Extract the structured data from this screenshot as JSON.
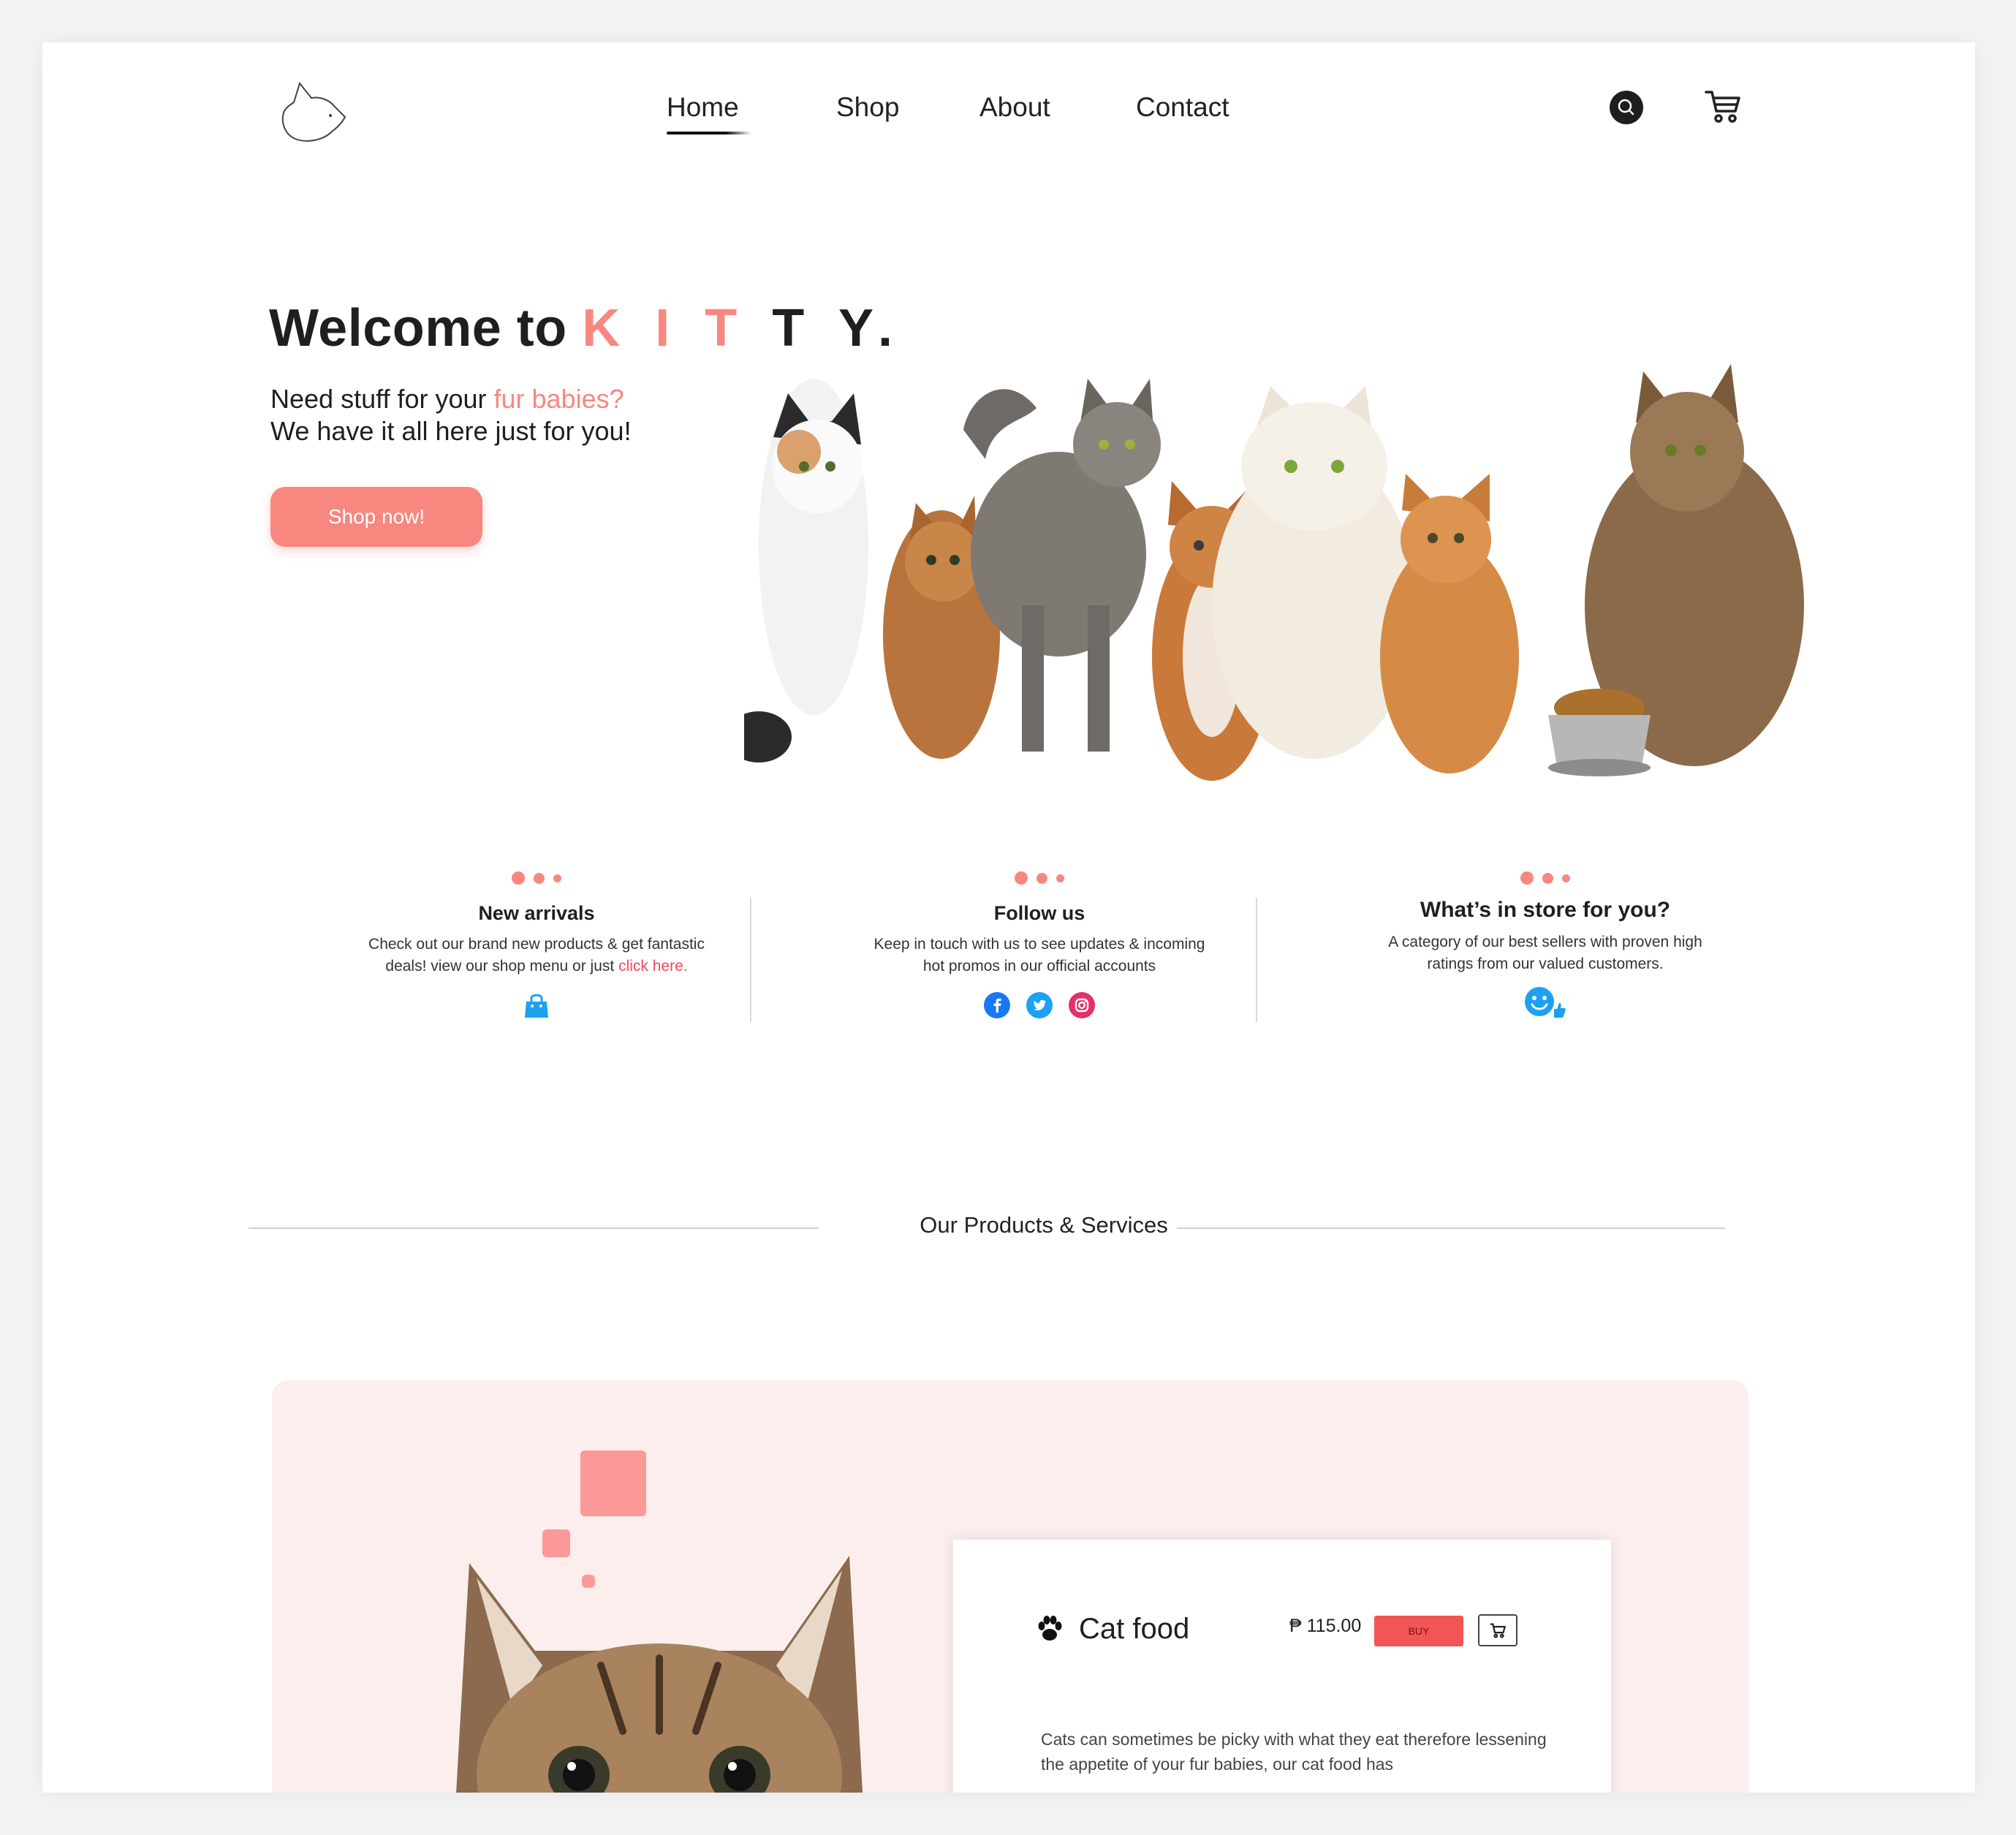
{
  "nav": {
    "items": [
      "Home",
      "Shop",
      "About",
      "Contact"
    ],
    "active": "Home",
    "logo_icon": "cat-head-outline-icon",
    "search_icon": "search-icon",
    "cart_icon": "cart-icon"
  },
  "hero": {
    "title_prefix": "Welcome to ",
    "title_brand_pink": "K I T",
    "title_brand_dark": " T Y.",
    "subtitle_line1_prefix": "Need stuff for your ",
    "subtitle_line1_highlight": "fur babies?",
    "subtitle_line2": "We have it all here just for you!",
    "cta_label": "Shop now!"
  },
  "info": {
    "new_arrivals": {
      "title": "New arrivals",
      "text_line1": "Check out our brand new products  & get fantastic",
      "text_line2_prefix": "deals! view our shop menu or just ",
      "link_text": "click here.",
      "icon": "shopping-bag-icon"
    },
    "follow_us": {
      "title": "Follow us",
      "text_line1": "Keep in touch with us to see updates & incoming",
      "text_line2": "hot promos in our official accounts",
      "icons": [
        "facebook-icon",
        "twitter-icon",
        "instagram-icon"
      ]
    },
    "store": {
      "title": "What’s in store for you?",
      "text_line1": "A category of our best sellers with proven high",
      "text_line2": "ratings from our valued customers.",
      "icon": "smile-thumbs-up-icon"
    }
  },
  "section_title": "Our Products & Services",
  "product": {
    "name": "Cat food",
    "price": "₱ 115.00",
    "buy_label": "BUY",
    "description": "Cats can sometimes be picky with what they eat therefore lessening the appetite of your fur babies, our cat food has"
  },
  "colors": {
    "accent": "#f8877f",
    "panel_bg": "#fdeeee",
    "buy_red": "#f25555",
    "facebook": "#1877f2",
    "twitter": "#1da1f2",
    "instagram": "#e1306c",
    "icon_blue": "#1ea0f0"
  }
}
